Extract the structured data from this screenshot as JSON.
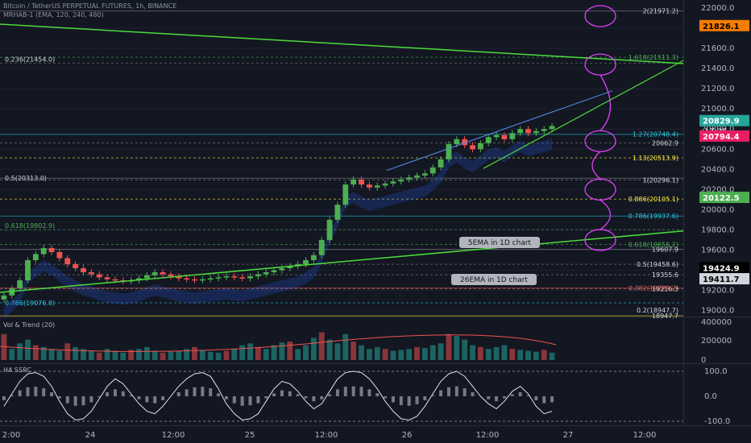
{
  "header": {
    "title": "Bitcoin / TetherUS PERPETUAL FUTURES, 1h, BINANCE",
    "indicator": "MRHAB-1 (EMA, 120, 240, 480)"
  },
  "panes": {
    "volume_label": "Vol & Trend (20)",
    "osc_label": "HA SSRC"
  },
  "price_axis": {
    "ticks": [
      "22000.0",
      "21800.0",
      "21600.0",
      "21400.0",
      "21200.0",
      "21000.0",
      "20800.0",
      "20600.0",
      "20400.0",
      "20200.0",
      "20000.0",
      "19800.0",
      "19600.0",
      "19400.0",
      "19200.0",
      "19000.0"
    ],
    "vol_ticks": [
      "400000",
      "200000",
      "0"
    ],
    "osc_ticks": [
      "100.0",
      "0.0",
      "-100.0"
    ]
  },
  "time_axis": [
    "2:00",
    "24",
    "12:00",
    "25",
    "12:00",
    "26",
    "12:00",
    "27",
    "12:00"
  ],
  "badges": {
    "last_price": "20829.9",
    "countdown": "17:35",
    "level_21826": "21826.1",
    "level_20794": "20794.4",
    "level_20122": "20122.5",
    "level_19424": "19424.9",
    "level_19411": "19411.7"
  },
  "fib_labels": {
    "right": [
      "2(21971.2)",
      "1.618(21511.3)",
      "1.27(20748.4)",
      "20662.9",
      "1.13(20513.9)",
      "1(20296.1)",
      "0.886(20105.1)",
      "0.786(19937.6)",
      "0.618(19656.2)",
      "19607.9",
      "0.5(19458.6)",
      "19355.6",
      "0.382(19223.2)",
      "19216.3",
      "0.2(18947.7)",
      "18947.7"
    ],
    "left": [
      "0.236(21454.0)",
      "0.5(20313.0)",
      "0.618(19802.9)",
      "0.786(19076.8)"
    ]
  },
  "annotations": [
    "5EMA in 1D chart",
    "26EMA in 1D chart"
  ],
  "colors": {
    "background": "#131722",
    "up": "#26a69a",
    "up_bright": "#4caf50",
    "down": "#ef5350",
    "trend_green": "#4cdc3c",
    "trend_blue": "#5b8def",
    "ellipse": "#e040fb",
    "fib_yellow": "#ffeb3b",
    "fib_cyan": "#26c6da"
  },
  "chart_data": {
    "type": "candlestick",
    "ylim": [
      18900,
      22050
    ],
    "levels": [
      21971.2,
      21511.3,
      21454.0,
      20748.4,
      20662.9,
      20513.9,
      20313.0,
      20296.1,
      20105.1,
      19937.6,
      19802.9,
      19656.2,
      19607.9,
      19458.6,
      19355.6,
      19223.2,
      19216.3,
      19076.8,
      18947.7
    ],
    "series": [
      {
        "values": [
          19150,
          19220,
          19300,
          19500,
          19560,
          19620,
          19580,
          19520,
          19460,
          19420,
          19380,
          19360,
          19330,
          19310,
          19300,
          19290,
          19300,
          19320,
          19350,
          19380,
          19360,
          19340,
          19320,
          19310,
          19300,
          19310,
          19320,
          19330,
          19340,
          19330,
          19320,
          19340,
          19360,
          19380,
          19400,
          19420,
          19440,
          19460,
          19500,
          19550,
          19700,
          19900,
          20050,
          20250,
          20300,
          20250,
          20220,
          20240,
          20260,
          20280,
          20300,
          20320,
          20340,
          20360,
          20420,
          20500,
          20650,
          20700,
          20640,
          20600,
          20660,
          20720,
          20740,
          20700,
          20760,
          20800,
          20760,
          20780,
          20800,
          20830
        ]
      }
    ],
    "volume": [
      140,
      60,
      90,
      110,
      80,
      70,
      60,
      50,
      90,
      70,
      60,
      50,
      40,
      60,
      50,
      40,
      55,
      60,
      70,
      50,
      40,
      45,
      50,
      60,
      70,
      55,
      45,
      40,
      50,
      60,
      80,
      90,
      70,
      60,
      80,
      95,
      100,
      60,
      80,
      120,
      150,
      110,
      90,
      140,
      100,
      80,
      60,
      70,
      60,
      50,
      55,
      60,
      70,
      65,
      80,
      90,
      140,
      130,
      110,
      80,
      70,
      60,
      70,
      80,
      60,
      55,
      50,
      45,
      55,
      40
    ],
    "oscillator": [
      -40,
      10,
      60,
      90,
      95,
      80,
      40,
      -20,
      -70,
      -95,
      -90,
      -60,
      -10,
      40,
      70,
      50,
      10,
      -30,
      -60,
      -70,
      -40,
      0,
      40,
      70,
      90,
      95,
      80,
      30,
      -30,
      -70,
      -95,
      -90,
      -70,
      -20,
      30,
      60,
      50,
      20,
      -20,
      -50,
      -30,
      20,
      70,
      95,
      100,
      95,
      70,
      30,
      -20,
      -60,
      -90,
      -95,
      -80,
      -40,
      10,
      60,
      90,
      100,
      80,
      40,
      0,
      -30,
      -50,
      -20,
      20,
      40,
      10,
      -40,
      -70,
      -60
    ]
  }
}
